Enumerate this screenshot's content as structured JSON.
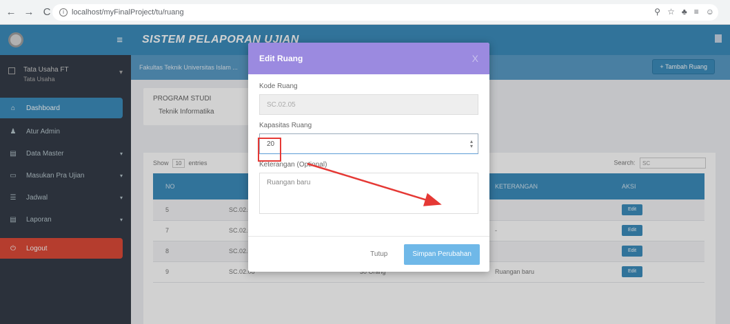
{
  "browser": {
    "url": "localhost/myFinalProject/tu/ruang",
    "icons": [
      "arrow-left-icon",
      "arrow-right-icon",
      "reload-icon",
      "info-icon",
      "zoom-icon",
      "star-icon",
      "extension-icon",
      "menu-icon",
      "profile-icon"
    ]
  },
  "header": {
    "title": "SISTEM PELAPORAN UJIAN"
  },
  "sidebar": {
    "user": {
      "name": "Tata Usaha FT",
      "role": "Tata Usaha"
    },
    "items": [
      {
        "label": "Dashboard",
        "icon": "home-icon",
        "glyph": "⌂",
        "active": true,
        "caret": ""
      },
      {
        "label": "Atur Admin",
        "icon": "user-icon",
        "glyph": "♟",
        "active": false,
        "caret": ""
      },
      {
        "label": "Data Master",
        "icon": "folder-icon",
        "glyph": "▤",
        "active": false,
        "caret": "▾"
      },
      {
        "label": "Masukan Pra Ujian",
        "icon": "inbox-icon",
        "glyph": "▭",
        "active": false,
        "caret": "▾"
      },
      {
        "label": "Jadwal",
        "icon": "table-icon",
        "glyph": "☰",
        "active": false,
        "caret": "▾"
      },
      {
        "label": "Laporan",
        "icon": "file-icon",
        "glyph": "▤",
        "active": false,
        "caret": "▾"
      }
    ],
    "logout": {
      "label": "Logout",
      "icon": "power-icon",
      "glyph": "⏻"
    }
  },
  "breadcrumb": {
    "text": "Fakultas Teknik Universitas Islam ..."
  },
  "toolbar": {
    "add_label": "+ Tambah Ruang"
  },
  "program": {
    "label": "PROGRAM STUDI",
    "value": "Teknik Informatika"
  },
  "table": {
    "show_label": "Show",
    "show_value": "10",
    "entries_label": "entries",
    "search_label": "Search:",
    "search_value": "SC",
    "columns": [
      "NO",
      "",
      "",
      "KETERANGAN",
      "AKSI"
    ],
    "rows": [
      {
        "no": "5",
        "kode": "SC.02.0",
        "kapasitas": "",
        "keterangan": "",
        "aksi": "Edit"
      },
      {
        "no": "7",
        "kode": "SC.02.0",
        "kapasitas": "",
        "keterangan": "-",
        "aksi": "Edit"
      },
      {
        "no": "8",
        "kode": "SC.02.07",
        "kapasitas": "30 Orang",
        "keterangan": "",
        "aksi": "Edit"
      },
      {
        "no": "9",
        "kode": "SC.02.08",
        "kapasitas": "30 Orang",
        "keterangan": "Ruangan baru",
        "aksi": "Edit"
      }
    ]
  },
  "modal": {
    "title": "Edit Ruang",
    "close_glyph": "X",
    "kode_label": "Kode Ruang",
    "kode_value": "SC.02.05",
    "kapasitas_label": "Kapasitas Ruang",
    "kapasitas_value": "20",
    "keterangan_label": "Keterangan (Optional)",
    "keterangan_value": "Ruangan baru",
    "tutup_label": "Tutup",
    "simpan_label": "Simpan Perubahan"
  },
  "colors": {
    "primary": "#3c8dbc",
    "modal_header": "#9b8ae0",
    "save_button": "#6fb8e8",
    "logout": "#dd4b39",
    "annotation": "#e53935"
  }
}
